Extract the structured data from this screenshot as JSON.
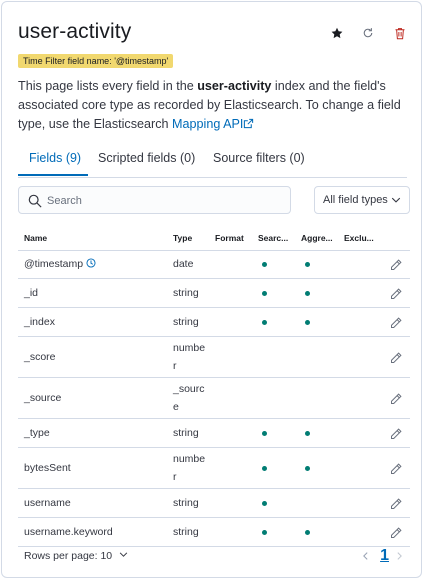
{
  "header": {
    "title": "user-activity",
    "time_filter_badge": "Time Filter field name: '@timestamp'",
    "description": {
      "part1": "This page lists every field in the ",
      "index_name": "user-activity",
      "part2": " index and the field's associated core type as recorded by Elasticsearch. To change a field type, use the Elasticsearch ",
      "link": "Mapping API"
    },
    "icons": [
      "star-icon",
      "refresh-icon",
      "delete-icon"
    ]
  },
  "tabs": [
    {
      "label": "Fields (9)",
      "active": true
    },
    {
      "label": "Scripted fields (0)",
      "active": false
    },
    {
      "label": "Source filters (0)",
      "active": false
    }
  ],
  "search": {
    "placeholder": "Search",
    "value": ""
  },
  "type_filter": {
    "label": "All field types"
  },
  "table": {
    "columns": [
      "Name",
      "Type",
      "Format",
      "Searc...",
      "Aggre...",
      "Exclu..."
    ],
    "rows": [
      {
        "name": "@timestamp",
        "type": "date",
        "format": "",
        "searchable": true,
        "aggregatable": true,
        "excluded": false,
        "time_field": true
      },
      {
        "name": "_id",
        "type": "string",
        "format": "",
        "searchable": true,
        "aggregatable": true,
        "excluded": false,
        "time_field": false
      },
      {
        "name": "_index",
        "type": "string",
        "format": "",
        "searchable": true,
        "aggregatable": true,
        "excluded": false,
        "time_field": false
      },
      {
        "name": "_score",
        "type": "number",
        "format": "",
        "searchable": false,
        "aggregatable": false,
        "excluded": false,
        "time_field": false
      },
      {
        "name": "_source",
        "type": "_source",
        "format": "",
        "searchable": false,
        "aggregatable": false,
        "excluded": false,
        "time_field": false
      },
      {
        "name": "_type",
        "type": "string",
        "format": "",
        "searchable": true,
        "aggregatable": true,
        "excluded": false,
        "time_field": false
      },
      {
        "name": "bytesSent",
        "type": "number",
        "format": "",
        "searchable": true,
        "aggregatable": true,
        "excluded": false,
        "time_field": false
      },
      {
        "name": "username",
        "type": "string",
        "format": "",
        "searchable": true,
        "aggregatable": false,
        "excluded": false,
        "time_field": false
      },
      {
        "name": "username.keyword",
        "type": "string",
        "format": "",
        "searchable": true,
        "aggregatable": true,
        "excluded": false,
        "time_field": false
      }
    ]
  },
  "footer": {
    "rows_per_page": "Rows per page: 10",
    "current_page": "1"
  },
  "colors": {
    "accent": "#006bb8",
    "dot": "#017d73",
    "badge": "#f1d86f",
    "delete": "#bd271e"
  }
}
